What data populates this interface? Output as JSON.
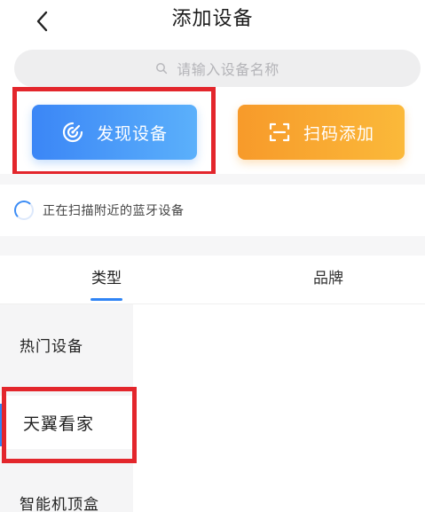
{
  "header": {
    "title": "添加设备",
    "back_icon": "chevron-left-icon"
  },
  "search": {
    "placeholder": "请输入设备名称",
    "icon": "search-icon"
  },
  "actions": {
    "discover_label": "发现设备",
    "discover_icon": "radar-scan-icon",
    "scan_label": "扫码添加",
    "scan_icon": "qr-scan-icon"
  },
  "scan_status": {
    "text": "正在扫描附近的蓝牙设备"
  },
  "tabs": [
    {
      "label": "类型",
      "active": true
    },
    {
      "label": "品牌",
      "active": false
    }
  ],
  "categories": [
    {
      "label": "热门设备"
    },
    {
      "label": "天翼看家",
      "selected": true
    },
    {
      "label": "智能机顶盒"
    }
  ],
  "colors": {
    "accent_blue": "#2f84f5",
    "discover_gradient": [
      "#3b86f6",
      "#5bb0fb"
    ],
    "scan_gradient": [
      "#f79a2a",
      "#fbb93a"
    ],
    "highlight_red": "#e3262c"
  }
}
